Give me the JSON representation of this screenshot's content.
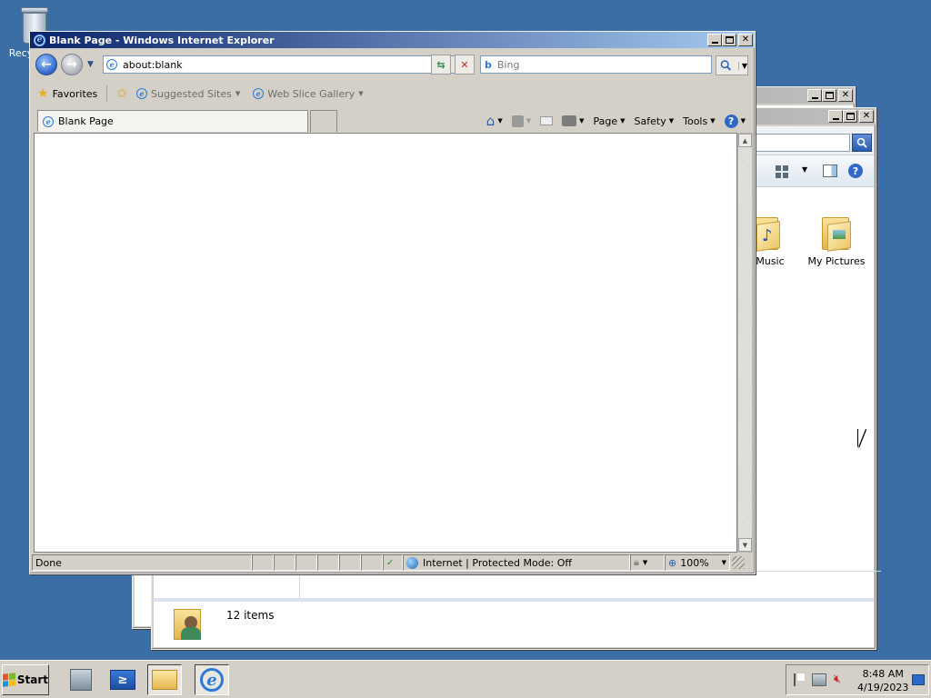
{
  "desktop": {
    "recycle_bin_label": "Recycle Bin",
    "visible_label_fragment": "Recy"
  },
  "explorer_back": {
    "title": ""
  },
  "explorer": {
    "folders": [
      {
        "label": "y Music",
        "icon": "music-folder-icon"
      },
      {
        "label": "My Pictures",
        "icon": "pictures-folder-icon"
      }
    ],
    "status_count": "12 items"
  },
  "ie": {
    "title": "Blank Page - Windows Internet Explorer",
    "address": "about:blank",
    "search_placeholder": "Bing",
    "favorites": {
      "favorites_label": "Favorites",
      "suggested_sites": "Suggested Sites",
      "web_slice_gallery": "Web Slice Gallery"
    },
    "tab_label": "Blank Page",
    "commands": {
      "page": "Page",
      "safety": "Safety",
      "tools": "Tools"
    },
    "status": {
      "done": "Done",
      "zone": "Internet | Protected Mode: Off",
      "zoom": "100%"
    }
  },
  "taskbar": {
    "start_label": "Start",
    "time": "8:48 AM",
    "date": "4/19/2023"
  },
  "colors": {
    "desktop": "#3a6ea5",
    "title_active": "#0a246a",
    "title_inactive": "#808080"
  }
}
